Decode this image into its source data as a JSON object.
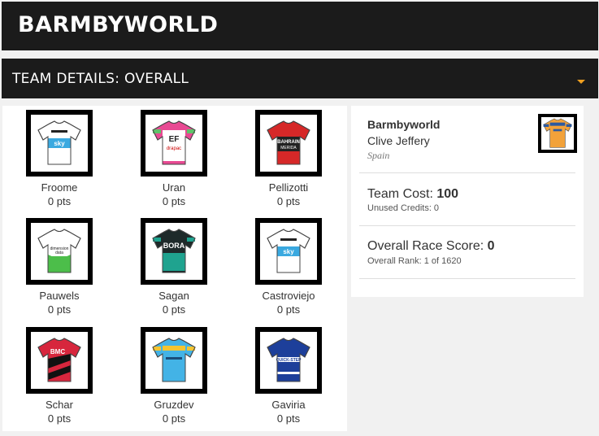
{
  "header": {
    "title": "BARMBYWORLD"
  },
  "section": {
    "title": "TEAM DETAILS: OVERALL",
    "caret_icon": "caret-down-icon",
    "accent": "#f0a020"
  },
  "riders": [
    {
      "name": "Froome",
      "points": "0 pts",
      "jersey": "sky"
    },
    {
      "name": "Uran",
      "points": "0 pts",
      "jersey": "ef-drapac"
    },
    {
      "name": "Pellizotti",
      "points": "0 pts",
      "jersey": "bahrain-merida"
    },
    {
      "name": "Pauwels",
      "points": "0 pts",
      "jersey": "dimension-data"
    },
    {
      "name": "Sagan",
      "points": "0 pts",
      "jersey": "bora-hansgrohe"
    },
    {
      "name": "Castroviejo",
      "points": "0 pts",
      "jersey": "sky"
    },
    {
      "name": "Schar",
      "points": "0 pts",
      "jersey": "bmc"
    },
    {
      "name": "Gruzdev",
      "points": "0 pts",
      "jersey": "astana"
    },
    {
      "name": "Gaviria",
      "points": "0 pts",
      "jersey": "quick-step"
    }
  ],
  "team": {
    "name": "Barmbyworld",
    "manager": "Clive Jeffery",
    "country": "Spain",
    "team_cost_label": "Team Cost:",
    "team_cost_value": "100",
    "unused_credits": "Unused Credits: 0",
    "race_score_label": "Overall Race Score:",
    "race_score_value": "0",
    "overall_rank": "Overall Rank: 1 of 1620"
  }
}
